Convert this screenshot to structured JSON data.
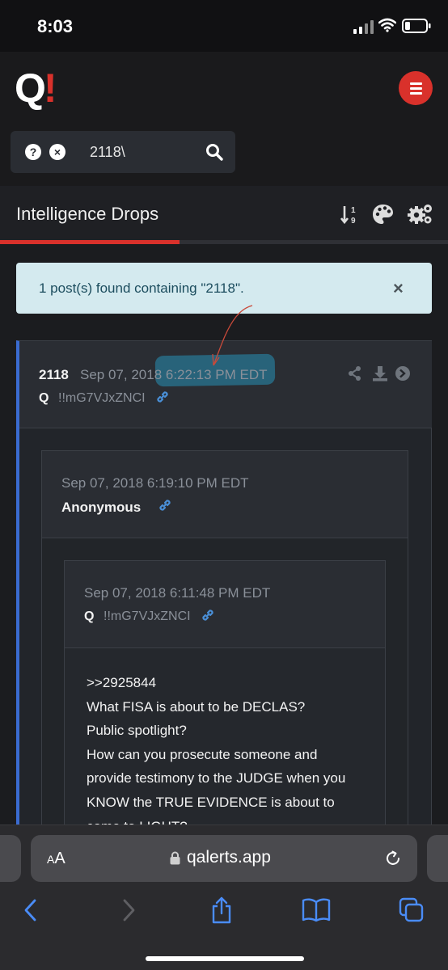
{
  "status_bar": {
    "time": "8:03"
  },
  "app": {
    "logo_letter": "Q",
    "logo_mark": "!",
    "menu_icon": "hamburger-icon",
    "brand_color": "#d9312b"
  },
  "search": {
    "value": "2118\\",
    "placeholder": ""
  },
  "section": {
    "title": "Intelligence Drops",
    "progress_fraction": 0.4
  },
  "alert": {
    "message": "1 post(s) found containing \"2118\".",
    "close_symbol": "×"
  },
  "post": {
    "number": "2118",
    "date": "Sep 07, 2018 6:22:13 PM EDT",
    "author": "Q",
    "tripcode": "!!mG7VJxZNCI",
    "accent_color": "#3a6bd0",
    "actions": [
      "share-icon",
      "download-icon",
      "arrow-circle-right-icon"
    ]
  },
  "quote1": {
    "date": "Sep 07, 2018 6:19:10 PM EDT",
    "author": "Anonymous"
  },
  "quote2": {
    "date": "Sep 07, 2018 6:11:48 PM EDT",
    "author": "Q",
    "tripcode": "!!mG7VJxZNCI",
    "body_lines": [
      ">>2925844",
      "What FISA is about to be DECLAS?",
      "Public spotlight?",
      "How can you prosecute someone and",
      "provide testimony to the JUDGE when you",
      "KNOW the TRUE EVIDENCE is about to",
      "come to LIGHT?"
    ]
  },
  "browser": {
    "aa_small": "A",
    "aa_large": "A",
    "url": "qalerts.app"
  }
}
